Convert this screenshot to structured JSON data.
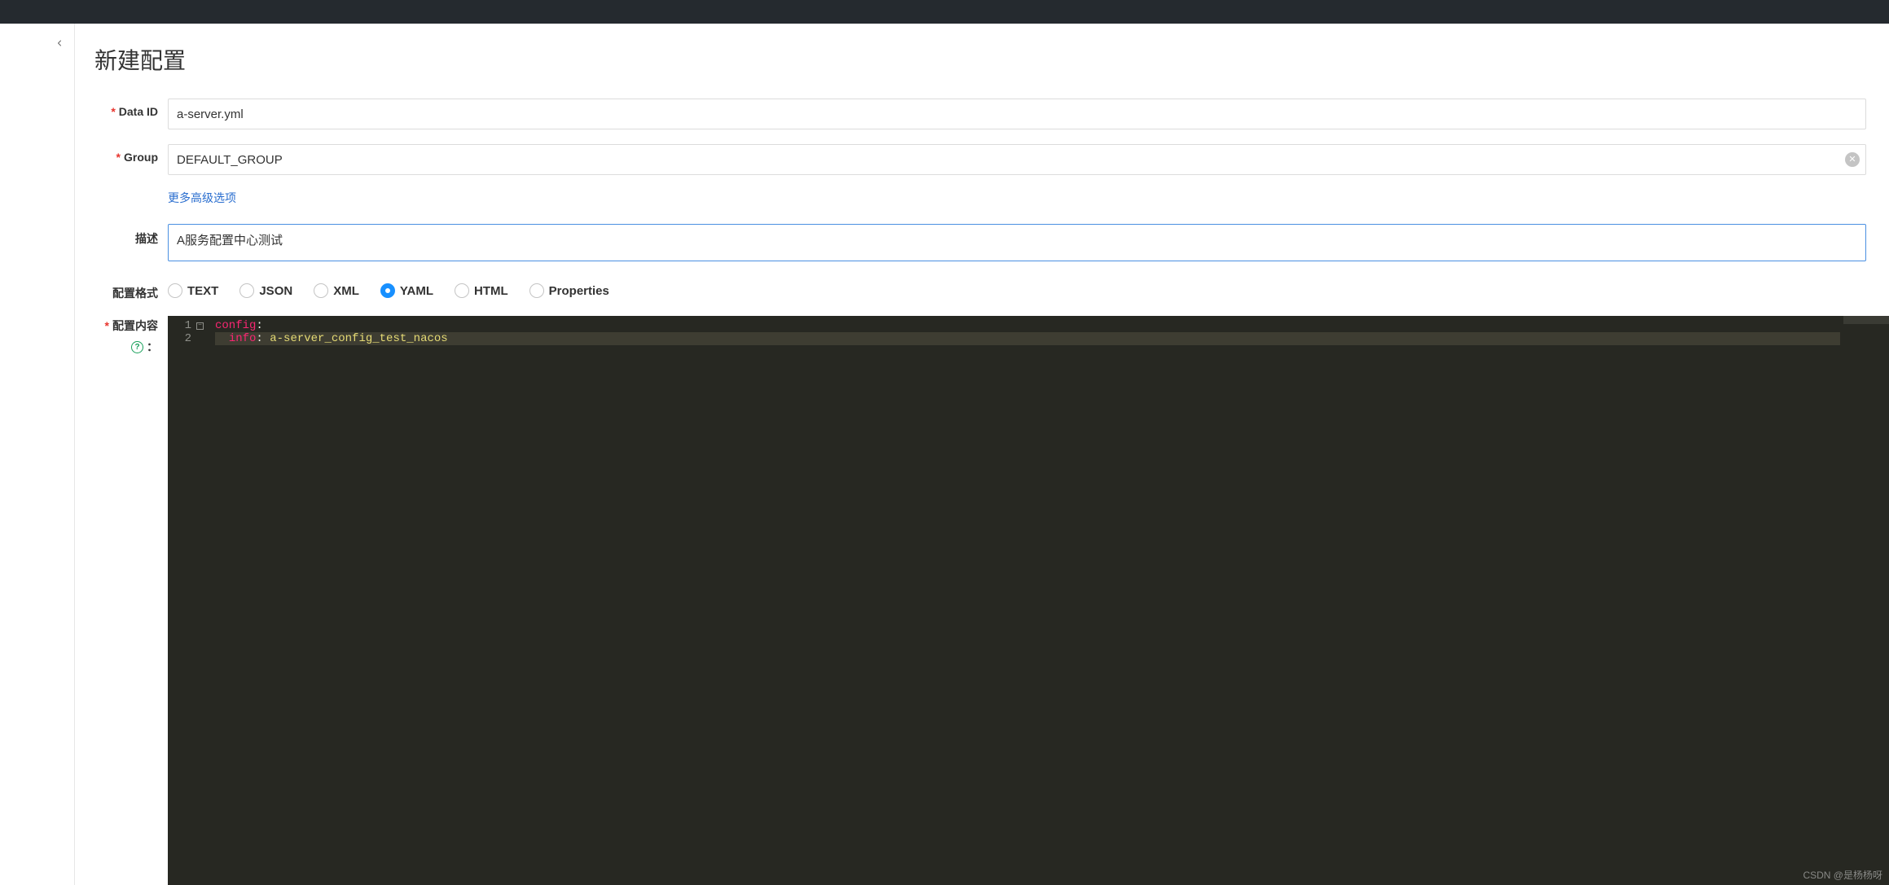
{
  "page": {
    "title": "新建配置"
  },
  "form": {
    "data_id": {
      "label": "Data ID",
      "value": "a-server.yml",
      "required": true
    },
    "group": {
      "label": "Group",
      "value": "DEFAULT_GROUP",
      "required": true
    },
    "advanced_link": "更多高级选项",
    "description": {
      "label": "描述",
      "value": "A服务配置中心测试"
    },
    "format": {
      "label": "配置格式",
      "options": [
        "TEXT",
        "JSON",
        "XML",
        "YAML",
        "HTML",
        "Properties"
      ],
      "selected": "YAML"
    },
    "content": {
      "label": "配置内容",
      "required": true,
      "help_colon": "：",
      "lines": [
        {
          "n": "1",
          "key": "config",
          "punct": ":",
          "val": "",
          "fold": true
        },
        {
          "n": "2",
          "indent": "  ",
          "key": "info",
          "punct": ": ",
          "val": "a-server_config_test_nacos",
          "active": true
        }
      ]
    }
  },
  "watermark": "CSDN @是杨杨呀"
}
